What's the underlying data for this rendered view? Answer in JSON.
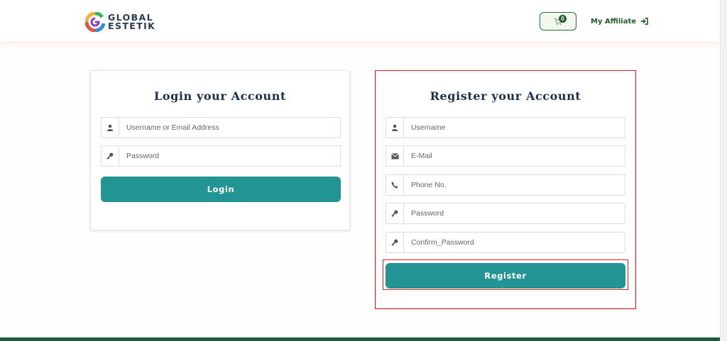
{
  "header": {
    "logo": {
      "line1": "GLOBAL",
      "line2": "ESTETIK"
    },
    "cart": {
      "count": "0",
      "icon": "cart-icon"
    },
    "affiliate": {
      "label": "My Affiliate",
      "icon": "sign-in-icon"
    }
  },
  "login": {
    "title": "Login your Account",
    "username_placeholder": "Username or Email Address",
    "password_placeholder": "Password",
    "button_label": "Login"
  },
  "register": {
    "title": "Register your Account",
    "username_placeholder": "Username",
    "email_placeholder": "E-Mail",
    "phone_placeholder": "Phone No.",
    "password_placeholder": "Password",
    "confirm_placeholder": "Confirm_Password",
    "button_label": "Register"
  },
  "colors": {
    "accent": "#229493",
    "brand_green": "#1f5b2c",
    "title": "#1d2f4a",
    "highlight": "#e02020"
  }
}
